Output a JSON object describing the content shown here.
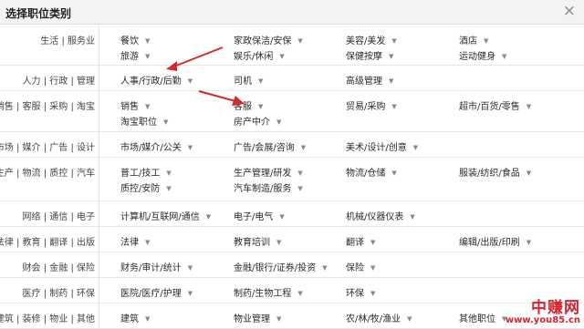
{
  "dialog": {
    "title": "选择职位类别",
    "close_symbol": "×"
  },
  "categories": [
    {
      "label": "生活 | 服务业",
      "options": [
        "餐饮",
        "家政保洁/安保",
        "美容/美发",
        "酒店",
        "旅游",
        "娱乐/休闲",
        "保健按摩",
        "运动健身"
      ]
    },
    {
      "label": "人力 | 行政 | 管理",
      "options": [
        "人事/行政/后勤",
        "司机",
        "高级管理"
      ]
    },
    {
      "label": "销售 | 客服 | 采购 | 淘宝",
      "options": [
        "销售",
        "客服",
        "贸易/采购",
        "超市/百货/零售",
        "淘宝职位",
        "房产中介"
      ]
    },
    {
      "label": "市场 | 媒介 | 广告 | 设计",
      "options": [
        "市场/媒介/公关",
        "广告/会展/咨询",
        "美术/设计/创意"
      ]
    },
    {
      "label": "生产 | 物流 | 质控 | 汽车",
      "options": [
        "普工/技工",
        "生产管理/研发",
        "物流/仓储",
        "服装/纺织/食品",
        "质控/安防",
        "汽车制造/服务"
      ]
    },
    {
      "label": "网络 | 通信 | 电子",
      "options": [
        "计算机/互联网/通信",
        "电子/电气",
        "机械/仪器仪表"
      ]
    },
    {
      "label": "法律 | 教育 | 翻译 | 出版",
      "options": [
        "法律",
        "教育培训",
        "翻译",
        "编辑/出版/印刷"
      ]
    },
    {
      "label": "财会 | 金融 | 保险",
      "options": [
        "财务/审计/统计",
        "金融/银行/证券/投资",
        "保险"
      ]
    },
    {
      "label": "医疗 | 制药 | 环保",
      "options": [
        "医院/医疗/护理",
        "制药/生物工程",
        "环保"
      ]
    },
    {
      "label": "建筑 | 装修 | 物业 | 其他",
      "options": [
        "建筑",
        "物业管理",
        "农/林/牧/渔业",
        "其他职位"
      ]
    }
  ],
  "watermark": {
    "main": "中赚网",
    "url": "www.you85.cn"
  },
  "colors": {
    "arrow": "#d42a2a",
    "watermark": "#d9212b",
    "border": "#e6e6e6",
    "header_bg": "#f3f3f3"
  }
}
